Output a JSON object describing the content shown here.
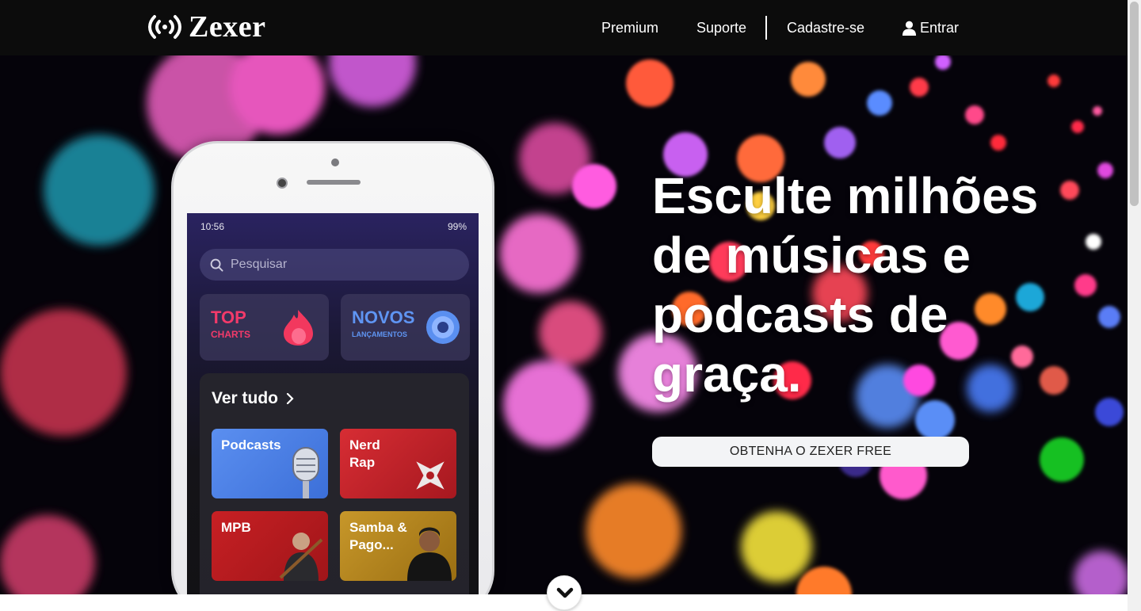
{
  "brand": {
    "name": "Zexer",
    "icon": "broadcast-icon"
  },
  "nav": {
    "premium": "Premium",
    "suporte": "Suporte",
    "cadastre": "Cadastre-se",
    "entrar": "Entrar",
    "entrar_icon": "user-icon"
  },
  "hero": {
    "title": "Esculte milhões de músicas e podcasts de graça.",
    "cta": "OBTENHA O ZEXER FREE"
  },
  "phone": {
    "status_time": "10:56",
    "status_right": "99%",
    "search_placeholder": "Pesquisar",
    "tiles": [
      {
        "big": "TOP",
        "small": "CHARTS",
        "icon": "flame-icon"
      },
      {
        "big": "NOVOS",
        "small": "LANÇAMENTOS",
        "icon": "disc-icon"
      }
    ],
    "see_all": "Ver tudo",
    "genres": [
      {
        "label": "Podcasts",
        "color": "#4f82ea"
      },
      {
        "label": "Nerd Rap",
        "color": "#c9232a"
      },
      {
        "label": "MPB",
        "color": "#b81b1f"
      },
      {
        "label": "Samba & Pago...",
        "color": "#b5861f"
      }
    ]
  },
  "controls": {
    "scroll_down_icon": "chevron-down-icon"
  },
  "colors": {
    "navbar": "#0c0c0c",
    "cta_bg": "#f3f4f6",
    "hero_bg": "#05030a"
  }
}
